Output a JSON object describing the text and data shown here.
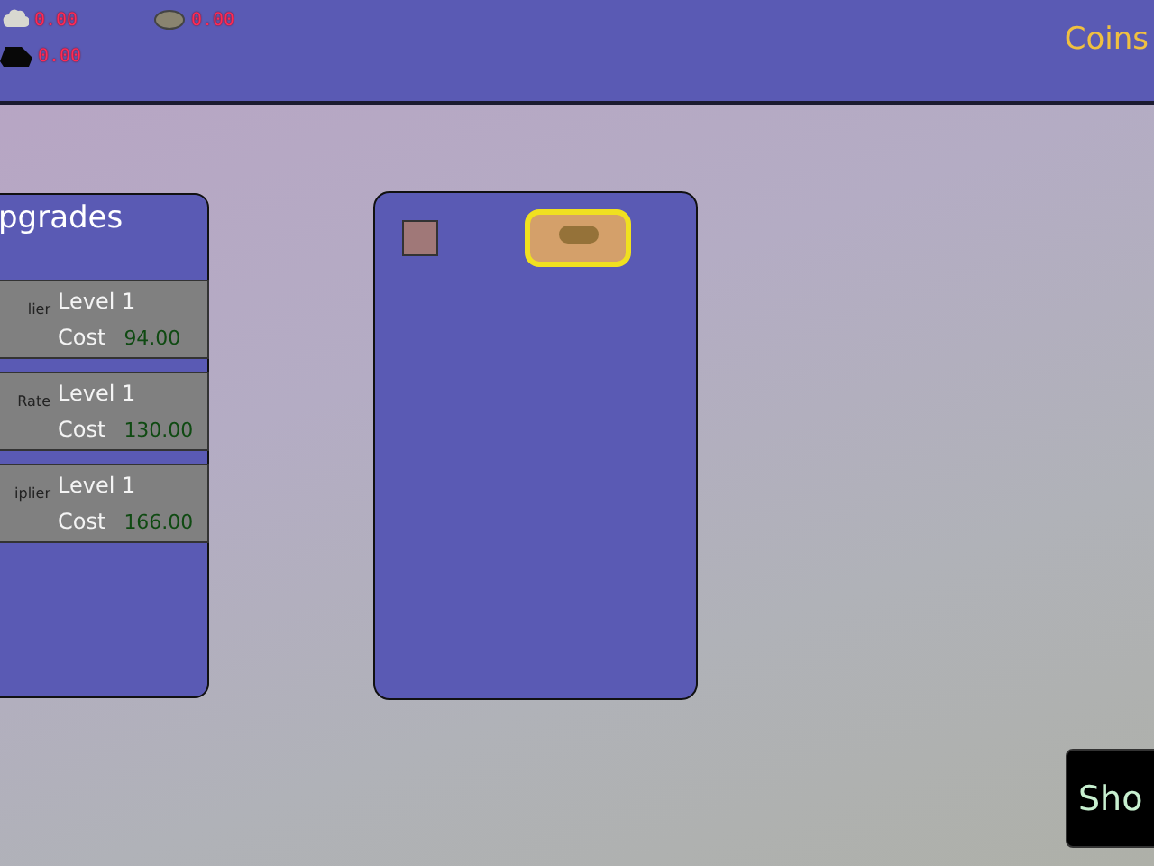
{
  "header": {
    "resources": [
      {
        "kind": "cloud",
        "amount": "0.00"
      },
      {
        "kind": "pebble",
        "amount": "0.00"
      },
      {
        "kind": "coal",
        "amount": "0.00"
      }
    ],
    "coins_label": "Coins"
  },
  "upgrades": {
    "title": "pgrades",
    "items": [
      {
        "name": "lier",
        "level": "Level 1",
        "cost_label": "Cost",
        "cost": "94.00"
      },
      {
        "name": "Rate",
        "level": "Level 1",
        "cost_label": "Cost",
        "cost": "130.00"
      },
      {
        "name": "iplier",
        "level": "Level 1",
        "cost_label": "Cost",
        "cost": "166.00"
      }
    ]
  },
  "inventory": {
    "slots": [
      {
        "kind": "empty",
        "selected": false
      },
      {
        "kind": "pebble",
        "selected": true
      }
    ]
  },
  "shop_button": "Sho"
}
